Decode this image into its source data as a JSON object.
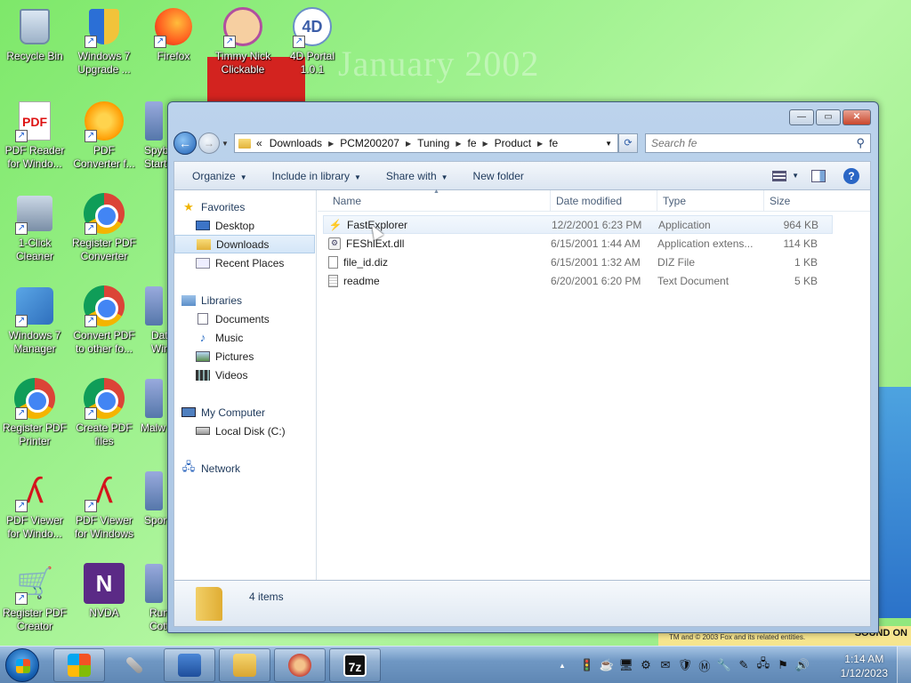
{
  "wallpaper": {
    "text": "January 2002",
    "bottom_caption": "TM and © 2003 Fox and its related entities.",
    "bottom_right": "SOUND ON"
  },
  "desktop_icons": [
    {
      "label": "Recycle Bin"
    },
    {
      "label": "Windows 7 Upgrade ..."
    },
    {
      "label": "Firefox"
    },
    {
      "label": "Timmy Nick Clickable"
    },
    {
      "label": "4D Portal 1.0.1"
    },
    {
      "label": "PDF Reader for Windo..."
    },
    {
      "label": "PDF Converter f..."
    },
    {
      "label": "Spyb Start"
    },
    {
      "label": "1-Click Cleaner"
    },
    {
      "label": "Register PDF Converter"
    },
    {
      "label": "Windows 7 Manager"
    },
    {
      "label": "Convert PDF to other fo..."
    },
    {
      "label": "Dat Wind"
    },
    {
      "label": "Register PDF Printer"
    },
    {
      "label": "Create PDF files"
    },
    {
      "label": "Malw"
    },
    {
      "label": "PDF Viewer for Windo..."
    },
    {
      "label": "PDF Viewer for Windows"
    },
    {
      "label": "Spor"
    },
    {
      "label": "Register PDF Creator"
    },
    {
      "label": "NVDA"
    },
    {
      "label": "Run Cott"
    }
  ],
  "window": {
    "minimize": "—",
    "maximize": "▭",
    "close": "✕",
    "address": {
      "overflow": "«",
      "crumbs": [
        "Downloads",
        "PCM200207",
        "Tuning",
        "fe",
        "Product",
        "fe"
      ]
    },
    "search_placeholder": "Search fe",
    "toolbar": {
      "organize": "Organize",
      "include_in_library": "Include in library",
      "share_with": "Share with",
      "new_folder": "New folder",
      "help": "?"
    },
    "nav_pane": {
      "favorites": "Favorites",
      "desktop": "Desktop",
      "downloads": "Downloads",
      "recent_places": "Recent Places",
      "libraries": "Libraries",
      "documents": "Documents",
      "music": "Music",
      "pictures": "Pictures",
      "videos": "Videos",
      "my_computer": "My Computer",
      "local_disk": "Local Disk (C:)",
      "network": "Network"
    },
    "columns": {
      "name": "Name",
      "date_modified": "Date modified",
      "type": "Type",
      "size": "Size"
    },
    "files": [
      {
        "name": "FastExplorer",
        "date": "12/2/2001 6:23 PM",
        "type": "Application",
        "size": "964 KB",
        "icon": "application-icon"
      },
      {
        "name": "FEShlExt.dll",
        "date": "6/15/2001 1:44 AM",
        "type": "Application extens...",
        "size": "114 KB",
        "icon": "dll-icon"
      },
      {
        "name": "file_id.diz",
        "date": "6/15/2001 1:32 AM",
        "type": "DIZ File",
        "size": "1 KB",
        "icon": "diz-file-icon"
      },
      {
        "name": "readme",
        "date": "6/20/2001 6:20 PM",
        "type": "Text Document",
        "size": "5 KB",
        "icon": "text-document-icon"
      }
    ],
    "status": {
      "item_count": "4 items"
    }
  },
  "taskbar": {
    "clock_time": "1:14 AM",
    "clock_date": "1/12/2023"
  }
}
